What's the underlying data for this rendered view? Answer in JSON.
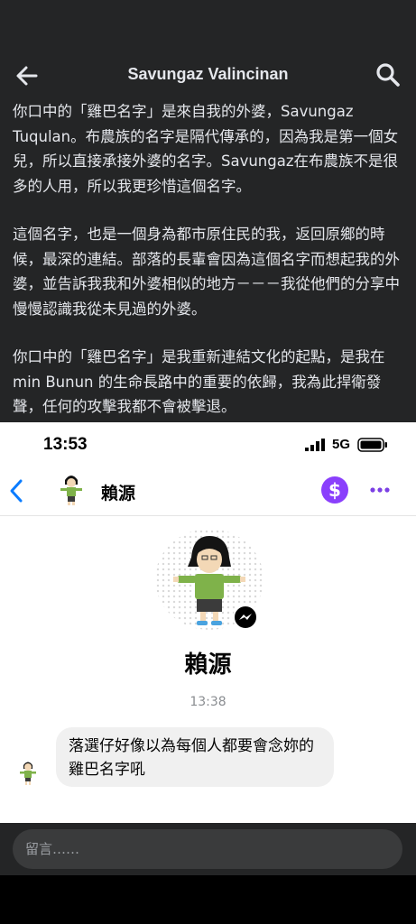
{
  "topbar": {
    "title": "Savungaz Valincinan"
  },
  "post": {
    "paragraphs": [
      "你口中的「雞巴名字」是來自我的外婆，Savungaz Tuqulan。布農族的名字是隔代傳承的，因為我是第一個女兒，所以直接承接外婆的名字。Savungaz在布農族不是很多的人用，所以我更珍惜這個名字。",
      "這個名字，也是一個身為都市原住民的我，返回原鄉的時候，最深的連結。部落的長輩會因為這個名字而想起我的外婆，並告訴我我和外婆相似的地方－－－我從他們的分享中慢慢認識我從未見過的外婆。",
      "你口中的「雞巴名字」是我重新連結文化的起點，是我在min Bunun 的生命長路中的重要的依歸，我為此捍衛發聲，任何的攻擊我都不會被擊退。"
    ]
  },
  "messenger": {
    "status": {
      "time": "13:53",
      "network": "5G"
    },
    "header": {
      "name": "賴源",
      "pay_symbol": "$"
    },
    "profile_name": "賴源",
    "timestamp": "13:38",
    "message": "落選仔好像以為每個人都要會念妳的雞巴名字吼"
  },
  "comment": {
    "placeholder": "留言……"
  },
  "colors": {
    "dark_bg": "#242526",
    "text_light": "#e4e6eb",
    "messenger_blue": "#0a7cff",
    "pay_purple": "#8a3ffc",
    "more_purple": "#7b3fe4"
  },
  "icons": [
    "back-arrow-icon",
    "search-icon",
    "signal-icon",
    "battery-icon",
    "chevron-left-icon",
    "dollar-icon",
    "more-dots-icon",
    "messenger-icon"
  ]
}
